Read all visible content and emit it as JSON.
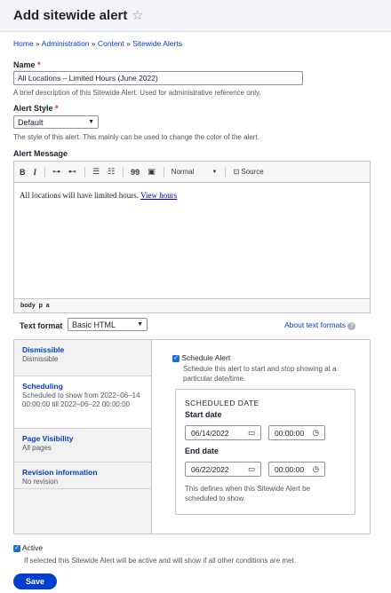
{
  "page": {
    "title": "Add sitewide alert"
  },
  "breadcrumb": [
    "Home",
    "Administration",
    "Content",
    "Sitewide Alerts"
  ],
  "name": {
    "label": "Name",
    "value": "All Locations – Limited Hours (June 2022)",
    "description": "A brief description of this Sitewide Alert. Used for administrative reference only."
  },
  "style": {
    "label": "Alert Style",
    "value": "Default",
    "description": "The style of this alert. This mainly can be used to change the color of the alert."
  },
  "message": {
    "label": "Alert Message",
    "toolbar": {
      "bold": "B",
      "italic": "I",
      "heading": "Normal",
      "source": "Source",
      "quote": "99"
    },
    "text": "All locations will have limited hours.",
    "link": "View hours",
    "path": [
      "body",
      "p",
      "a"
    ]
  },
  "text_format": {
    "label": "Text format",
    "value": "Basic HTML",
    "help_link": "About text formats"
  },
  "tabs": [
    {
      "title": "Dismissible",
      "summary": "Dismissible"
    },
    {
      "title": "Scheduling",
      "summary": "Scheduled to show from 2022–06–14 00:00:00 till 2022–06–22 00:00:00"
    },
    {
      "title": "Page Visibility",
      "summary": "All pages"
    },
    {
      "title": "Revision information",
      "summary": "No revision"
    }
  ],
  "scheduling": {
    "checkbox_label": "Schedule Alert",
    "checkbox_description": "Schedule this alert to start and stop showing at a particular date/time.",
    "fieldset_title": "SCHEDULED DATE",
    "start_label": "Start date",
    "start_date": "06/14/2022",
    "start_time": "00:00:00",
    "end_label": "End date",
    "end_date": "06/22/2022",
    "end_time": "00:00:00",
    "note": "This defines when this Sitewide Alert be scheduled to show."
  },
  "active": {
    "label": "Active",
    "description": "If selected this Sitewide Alert will be active and will show if all other conditions are met."
  },
  "save_label": "Save",
  "colors": {
    "primary": "#003ecc",
    "required": "#dc2323",
    "header_bg": "#f3f4f9"
  }
}
